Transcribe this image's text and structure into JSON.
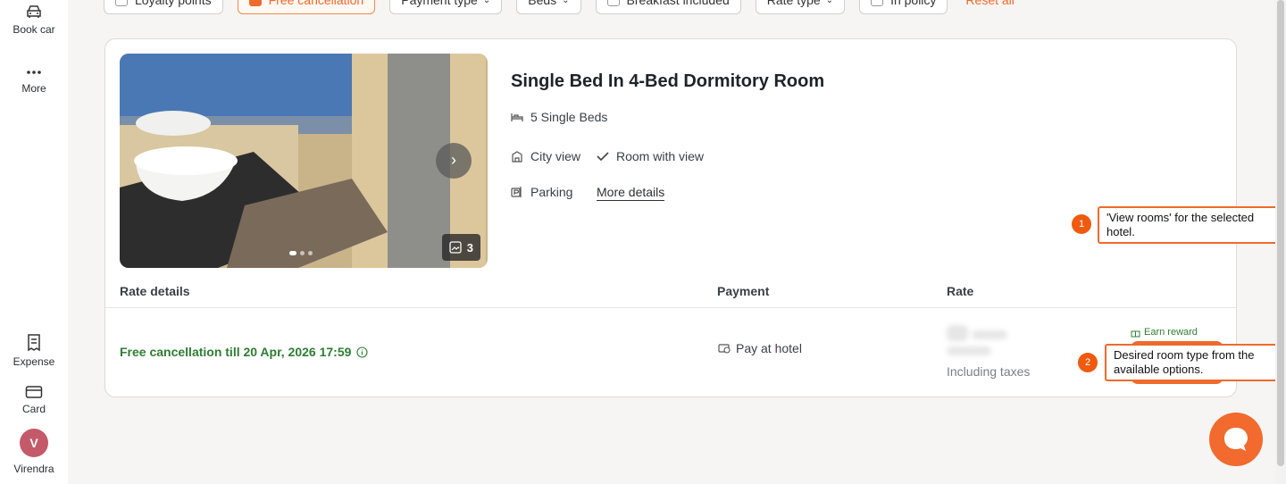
{
  "sidebar": {
    "items": [
      {
        "label": "Book car",
        "icon": "car-icon"
      },
      {
        "label": "More",
        "icon": "more-dots-icon"
      },
      {
        "label": "Expense",
        "icon": "receipt-icon"
      },
      {
        "label": "Card",
        "icon": "credit-card-icon"
      }
    ],
    "user": {
      "initial": "V",
      "name": "Virendra",
      "avatar_color": "#c4596a"
    }
  },
  "filters": {
    "chips": [
      {
        "label": "Loyalty points",
        "type": "checkbox",
        "checked": false
      },
      {
        "label": "Free cancellation",
        "type": "checkbox",
        "checked": true
      },
      {
        "label": "Payment type",
        "type": "dropdown"
      },
      {
        "label": "Beds",
        "type": "dropdown"
      },
      {
        "label": "Breakfast included",
        "type": "checkbox",
        "checked": false
      },
      {
        "label": "Rate type",
        "type": "dropdown"
      },
      {
        "label": "In policy",
        "type": "checkbox",
        "checked": false
      }
    ],
    "reset_label": "Reset all"
  },
  "room": {
    "title": "Single Bed In 4-Bed Dormitory Room",
    "photo_count": "3",
    "beds": "5 Single Beds",
    "views": [
      "City view",
      "Room with view"
    ],
    "parking": "Parking",
    "more_details": "More details"
  },
  "rates": {
    "headers": {
      "details": "Rate details",
      "payment": "Payment",
      "rate": "Rate"
    },
    "row": {
      "cancellation": "Free cancellation till 20 Apr, 2026 17:59",
      "payment": "Pay at hotel",
      "taxes_note": "Including taxes",
      "earn_reward": "Earn reward"
    }
  },
  "annotations": [
    {
      "number": "1",
      "text": "'View rooms' for the selected hotel."
    },
    {
      "number": "2",
      "text": "Desired room type from the available options."
    }
  ],
  "colors": {
    "accent": "#ef6a2c",
    "success": "#2e7d32"
  }
}
